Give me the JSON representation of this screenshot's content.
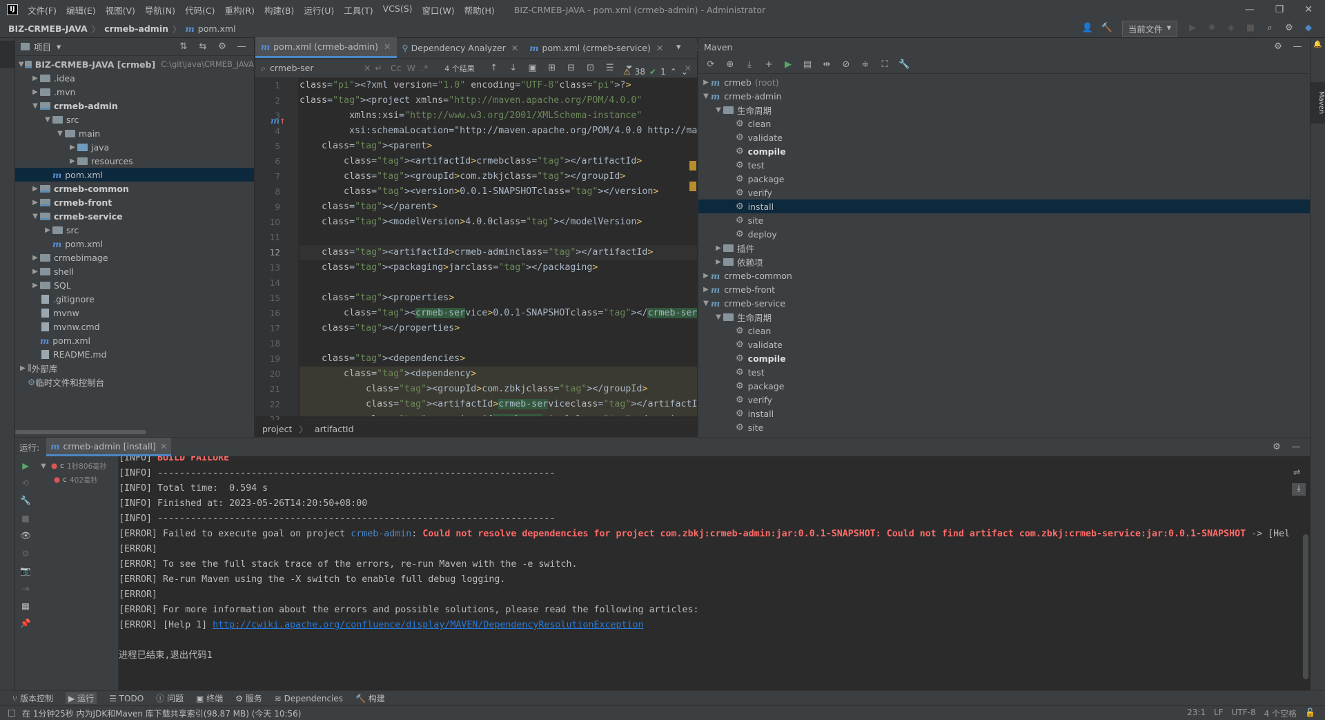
{
  "titlebar": {
    "menus": [
      "文件(F)",
      "编辑(E)",
      "视图(V)",
      "导航(N)",
      "代码(C)",
      "重构(R)",
      "构建(B)",
      "运行(U)",
      "工具(T)",
      "VCS(S)",
      "窗口(W)",
      "帮助(H)"
    ],
    "title": "BIZ-CRMEB-JAVA - pom.xml (crmeb-admin) - Administrator"
  },
  "navbar": {
    "crumbs": [
      "BIZ-CRMEB-JAVA",
      "crmeb-admin",
      "pom.xml"
    ],
    "run_config": "当前文件"
  },
  "project": {
    "title": "项目",
    "root_name": "BIZ-CRMEB-JAVA [crmeb]",
    "root_path": "C:\\git\\java\\CRMEB_JAVA",
    "nodes": [
      ".idea",
      ".mvn",
      "crmeb-admin",
      "src",
      "main",
      "java",
      "resources",
      "pom.xml",
      "crmeb-common",
      "crmeb-front",
      "crmeb-service",
      "src",
      "pom.xml",
      "crmebimage",
      "shell",
      "SQL",
      ".gitignore",
      "mvnw",
      "mvnw.cmd",
      "pom.xml",
      "README.md",
      "外部库",
      "临时文件和控制台"
    ]
  },
  "editor": {
    "tabs": [
      "pom.xml (crmeb-admin)",
      "Dependency Analyzer",
      "pom.xml (crmeb-service)"
    ],
    "search_text": "crmeb-ser",
    "search_opts": [
      "Cc",
      "W",
      ".*"
    ],
    "results": "4 个结果",
    "warnings": "38",
    "checks": "1",
    "line_numbers": [
      "1",
      "2",
      "3",
      "4",
      "5",
      "6",
      "7",
      "8",
      "9",
      "10",
      "11",
      "12",
      "13",
      "14",
      "15",
      "16",
      "17",
      "18",
      "19",
      "20",
      "21",
      "22",
      "23"
    ],
    "lines": [
      "<?xml version=\"1.0\" encoding=\"UTF-8\"?>",
      "<project xmlns=\"http://maven.apache.org/POM/4.0.0\"",
      "         xmlns:xsi=\"http://www.w3.org/2001/XMLSchema-instance\"",
      "         xsi:schemaLocation=\"http://maven.apache.org/POM/4.0.0 http://ma",
      "    <parent>",
      "        <artifactId>crmeb</artifactId>",
      "        <groupId>com.zbkj</groupId>",
      "        <version>0.0.1-SNAPSHOT</version>",
      "    </parent>",
      "    <modelVersion>4.0.0</modelVersion>",
      "",
      "    <artifactId>crmeb-admin</artifactId>",
      "    <packaging>jar</packaging>",
      "",
      "    <properties>",
      "        <crmeb-service>0.0.1-SNAPSHOT</crmeb-service>",
      "    </properties>",
      "",
      "    <dependencies>",
      "        <dependency>",
      "            <groupId>com.zbkj</groupId>",
      "            <artifactId>crmeb-service</artifactId>",
      "            <version>${crmeb-service}</version>"
    ],
    "breadcrumbs": [
      "project",
      "artifactId"
    ]
  },
  "maven": {
    "title": "Maven",
    "rows": [
      {
        "label": "crmeb",
        "extra": "(root)",
        "level": 0,
        "kind": "module",
        "arrow": "▶"
      },
      {
        "label": "crmeb-admin",
        "level": 0,
        "kind": "module",
        "arrow": "▼"
      },
      {
        "label": "生命周期",
        "level": 1,
        "kind": "folder",
        "arrow": "▼"
      },
      {
        "label": "clean",
        "level": 2,
        "kind": "goal"
      },
      {
        "label": "validate",
        "level": 2,
        "kind": "goal"
      },
      {
        "label": "compile",
        "level": 2,
        "kind": "goal",
        "bold": true
      },
      {
        "label": "test",
        "level": 2,
        "kind": "goal"
      },
      {
        "label": "package",
        "level": 2,
        "kind": "goal"
      },
      {
        "label": "verify",
        "level": 2,
        "kind": "goal"
      },
      {
        "label": "install",
        "level": 2,
        "kind": "goal",
        "selected": true
      },
      {
        "label": "site",
        "level": 2,
        "kind": "goal"
      },
      {
        "label": "deploy",
        "level": 2,
        "kind": "goal"
      },
      {
        "label": "插件",
        "level": 1,
        "kind": "folder",
        "arrow": "▶"
      },
      {
        "label": "依赖项",
        "level": 1,
        "kind": "folder",
        "arrow": "▶"
      },
      {
        "label": "crmeb-common",
        "level": 0,
        "kind": "module",
        "arrow": "▶"
      },
      {
        "label": "crmeb-front",
        "level": 0,
        "kind": "module",
        "arrow": "▶"
      },
      {
        "label": "crmeb-service",
        "level": 0,
        "kind": "module",
        "arrow": "▼"
      },
      {
        "label": "生命周期",
        "level": 1,
        "kind": "folder",
        "arrow": "▼"
      },
      {
        "label": "clean",
        "level": 2,
        "kind": "goal"
      },
      {
        "label": "validate",
        "level": 2,
        "kind": "goal"
      },
      {
        "label": "compile",
        "level": 2,
        "kind": "goal",
        "bold": true
      },
      {
        "label": "test",
        "level": 2,
        "kind": "goal"
      },
      {
        "label": "package",
        "level": 2,
        "kind": "goal"
      },
      {
        "label": "verify",
        "level": 2,
        "kind": "goal"
      },
      {
        "label": "install",
        "level": 2,
        "kind": "goal"
      },
      {
        "label": "site",
        "level": 2,
        "kind": "goal"
      }
    ]
  },
  "run": {
    "label": "运行:",
    "tab": "crmeb-admin [install]",
    "tree": [
      {
        "text": "c",
        "time": "1秒806毫秒"
      },
      {
        "text": "c",
        "time": "402毫秒"
      }
    ],
    "lines": [
      [
        {
          "t": "[INFO] "
        },
        {
          "t": "BUILD FAILURE",
          "c": "err"
        }
      ],
      [
        {
          "t": "[INFO] ------------------------------------------------------------------------"
        }
      ],
      [
        {
          "t": "[INFO] Total time:  0.594 s"
        }
      ],
      [
        {
          "t": "[INFO] Finished at: 2023-05-26T14:20:50+08:00"
        }
      ],
      [
        {
          "t": "[INFO] ------------------------------------------------------------------------"
        }
      ],
      [
        {
          "t": "[ERROR] Failed to execute goal on project "
        },
        {
          "t": "crmeb-admin",
          "c": "mod"
        },
        {
          "t": ": "
        },
        {
          "t": "Could not resolve dependencies for project com.zbkj:crmeb-admin:jar:0.0.1-SNAPSHOT: Could not find artifact com.zbkj:crmeb-service:jar:0.0.1-SNAPSHOT",
          "c": "err"
        },
        {
          "t": " -> [Hel"
        }
      ],
      [
        {
          "t": "[ERROR] "
        }
      ],
      [
        {
          "t": "[ERROR] To see the full stack trace of the errors, re-run Maven with the -e switch."
        }
      ],
      [
        {
          "t": "[ERROR] Re-run Maven using the -X switch to enable full debug logging."
        }
      ],
      [
        {
          "t": "[ERROR] "
        }
      ],
      [
        {
          "t": "[ERROR] For more information about the errors and possible solutions, please read the following articles:"
        }
      ],
      [
        {
          "t": "[ERROR] [Help 1] "
        },
        {
          "t": "http://cwiki.apache.org/confluence/display/MAVEN/DependencyResolutionException",
          "c": "link"
        }
      ],
      [
        {
          "t": ""
        }
      ],
      [
        {
          "t": "进程已结束,退出代码1"
        }
      ]
    ]
  },
  "toolwindows": [
    "版本控制",
    "运行",
    "TODO",
    "问题",
    "终端",
    "服务",
    "Dependencies",
    "构建"
  ],
  "status": {
    "message": "在 1分钟25秒 内为JDK和Maven 库下载共享索引(98.87 MB) (今天 10:56)",
    "position": "23:1",
    "line_sep": "LF",
    "encoding": "UTF-8",
    "indent": "4 个空格"
  },
  "colors": {
    "accent": "#4a88c7",
    "error": "#ff6b68",
    "selection": "#0d293e"
  }
}
